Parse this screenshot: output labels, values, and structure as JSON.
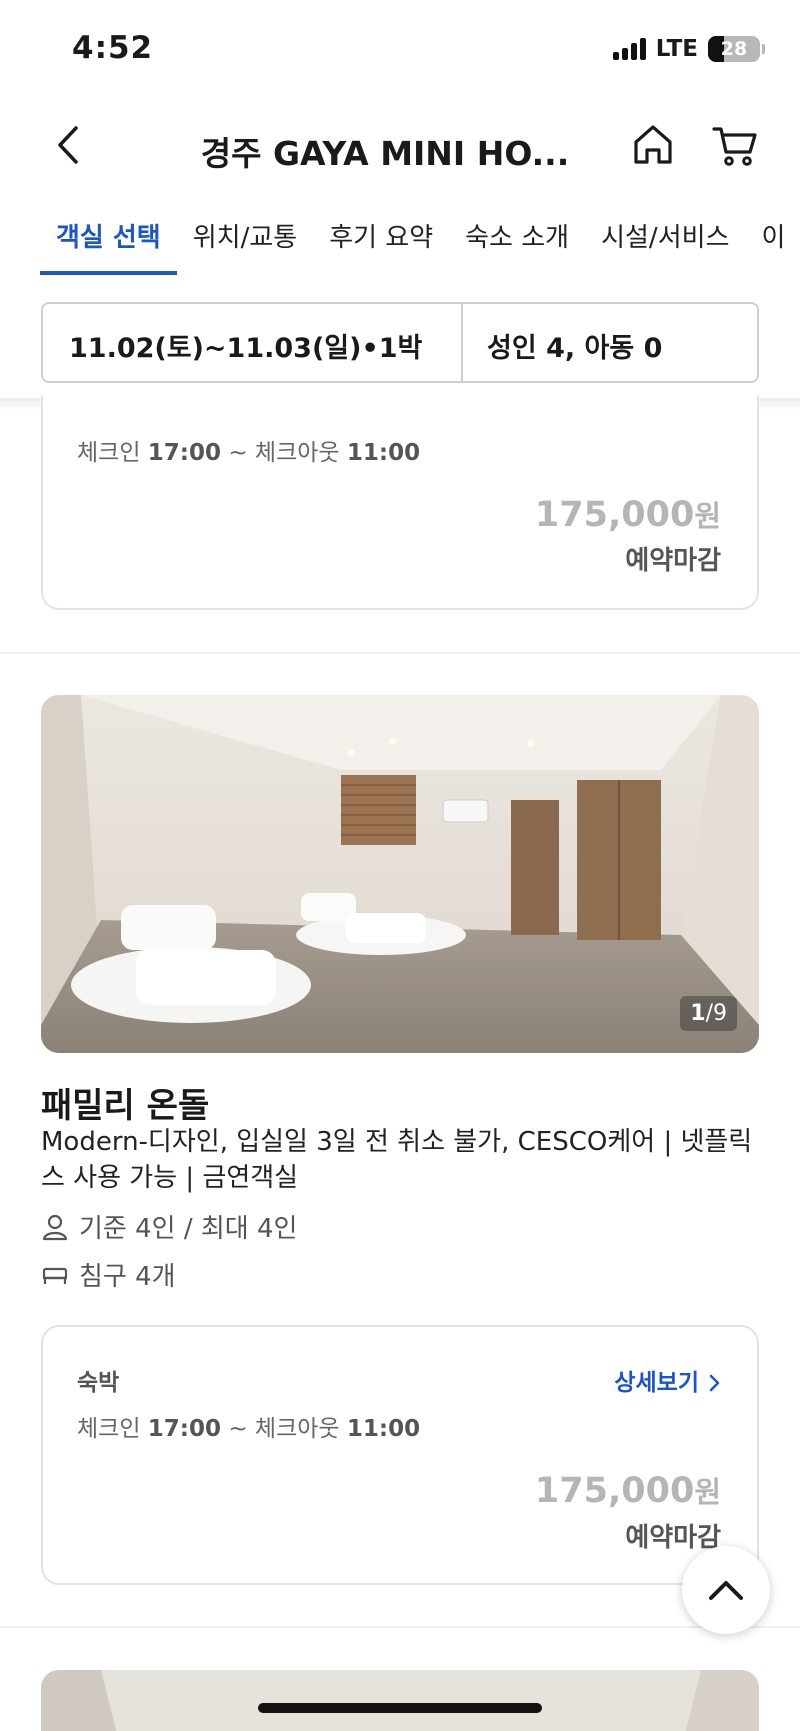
{
  "status_bar": {
    "time": "4:52",
    "network": "LTE",
    "battery": "28"
  },
  "nav": {
    "title": "경주 GAYA MINI HO..."
  },
  "tabs": [
    {
      "label": "객실 선택",
      "active": true
    },
    {
      "label": "위치/교통",
      "active": false
    },
    {
      "label": "후기 요약",
      "active": false
    },
    {
      "label": "숙소 소개",
      "active": false
    },
    {
      "label": "시설/서비스",
      "active": false
    },
    {
      "label": "이",
      "active": false
    }
  ],
  "filter": {
    "dates": "11.02(토)~11.03(일)•1박",
    "guests": "성인 4, 아동 0"
  },
  "plans": [
    {
      "time_prefix": "체크인 ",
      "checkin": "17:00",
      "time_mid": " ~ 체크아웃 ",
      "checkout": "11:00",
      "price": "175,000",
      "price_unit": "원",
      "status": "예약마감"
    },
    {
      "type": "숙박",
      "detail": "상세보기",
      "time_prefix": "체크인 ",
      "checkin": "17:00",
      "time_mid": " ~ 체크아웃 ",
      "checkout": "11:00",
      "price": "175,000",
      "price_unit": "원",
      "status": "예약마감"
    }
  ],
  "room": {
    "photo_index": "1",
    "photo_total": "/9",
    "name": "패밀리 온돌",
    "description": "Modern-디자인, 입실일 3일 전 취소 불가, CESCO케어 | 넷플릭스 사용 가능 | 금연객실",
    "capacity": "기준 4인 / 최대 4인",
    "bedding": "침구 4개"
  },
  "colors": {
    "accent": "#1a55c9",
    "price_closed": "#b5b5b5"
  }
}
